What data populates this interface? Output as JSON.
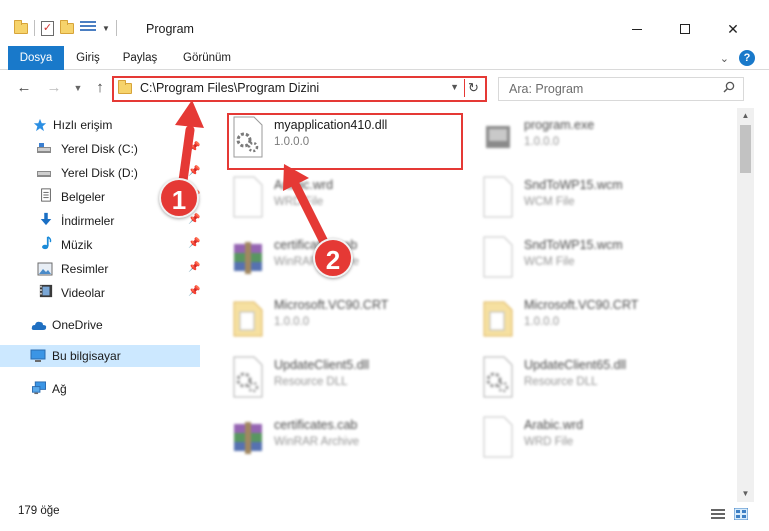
{
  "window": {
    "title": "Program",
    "controls": {
      "minimize": "minimize",
      "maximize": "maximize",
      "close": "✕"
    }
  },
  "ribbon": {
    "tabs": [
      "Dosya",
      "Giriş",
      "Paylaş",
      "Görünüm"
    ],
    "help": "?"
  },
  "address_bar": {
    "path": "C:\\Program Files\\Program Dizini"
  },
  "search": {
    "placeholder": "Ara: Program"
  },
  "sidebar": {
    "items": [
      {
        "label": "Hızlı erişim",
        "icon": "star-icon"
      },
      {
        "label": "Yerel Disk (C:)",
        "icon": "drive-icon",
        "pinned": true
      },
      {
        "label": "Yerel Disk (D:)",
        "icon": "drive-icon",
        "pinned": true
      },
      {
        "label": "Belgeler",
        "icon": "documents-icon",
        "pinned": true
      },
      {
        "label": "İndirmeler",
        "icon": "download-icon",
        "pinned": true
      },
      {
        "label": "Müzik",
        "icon": "music-icon",
        "pinned": true
      },
      {
        "label": "Resimler",
        "icon": "pictures-icon",
        "pinned": true
      },
      {
        "label": "Videolar",
        "icon": "videos-icon",
        "pinned": true
      },
      {
        "label": "OneDrive",
        "icon": "cloud-icon"
      },
      {
        "label": "Bu bilgisayar",
        "icon": "computer-icon",
        "selected": true
      },
      {
        "label": "Ağ",
        "icon": "network-icon"
      }
    ]
  },
  "files": [
    {
      "name": "myapplication410.dll",
      "sub": "1.0.0.0",
      "icon": "dll-icon",
      "highlighted": true
    },
    {
      "name": "program.exe",
      "sub": "1.0.0.0",
      "icon": "exe-icon"
    },
    {
      "name": "Arabic.wrd",
      "sub": "WRD File",
      "icon": "blank-file-icon"
    },
    {
      "name": "SndToWP15.wcm",
      "sub": "WCM File",
      "icon": "blank-file-icon"
    },
    {
      "name": "certificates.cab",
      "sub": "WinRAR Archive",
      "icon": "winrar-icon"
    },
    {
      "name": "SndToWP15.wcm",
      "sub": "WCM File",
      "icon": "blank-file-icon"
    },
    {
      "name": "Microsoft.VC90.CRT",
      "sub": "1.0.0.0",
      "icon": "folder-doc-icon"
    },
    {
      "name": "Microsoft.VC90.CRT",
      "sub": "1.0.0.0",
      "icon": "folder-doc-icon"
    },
    {
      "name": "UpdateClient5.dll",
      "sub": "Resource DLL",
      "icon": "dll-icon"
    },
    {
      "name": "UpdateClient65.dll",
      "sub": "Resource DLL",
      "icon": "dll-icon"
    },
    {
      "name": "certificates.cab",
      "sub": "WinRAR Archive",
      "icon": "winrar-icon"
    },
    {
      "name": "Arabic.wrd",
      "sub": "WRD File",
      "icon": "blank-file-icon"
    }
  ],
  "status": {
    "count": "179 öğe"
  },
  "annotations": [
    {
      "label": "1",
      "color": "#e53935"
    },
    {
      "label": "2",
      "color": "#e53935"
    }
  ],
  "colors": {
    "accent": "#1979ca",
    "highlight": "#e53935",
    "selected_bg": "#cce8ff"
  }
}
